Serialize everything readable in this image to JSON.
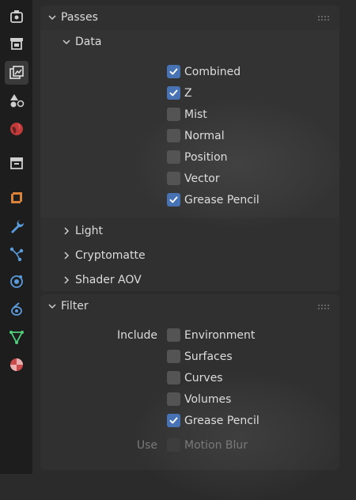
{
  "sidebar": {
    "tabs": [
      {
        "icon": "tool-icon",
        "active": false
      },
      {
        "icon": "render-icon",
        "active": false
      },
      {
        "icon": "view-layer-icon",
        "active": true
      },
      {
        "icon": "scene-icon",
        "active": false
      },
      {
        "icon": "world-icon",
        "active": false
      },
      {
        "icon": "collection-icon",
        "active": false
      },
      {
        "icon": "object-icon",
        "active": false
      },
      {
        "icon": "modifier-wrench-icon",
        "active": false
      },
      {
        "icon": "particles-icon",
        "active": false
      },
      {
        "icon": "physics-icon",
        "active": false
      },
      {
        "icon": "constraints-icon",
        "active": false
      },
      {
        "icon": "object-data-icon",
        "active": false
      },
      {
        "icon": "material-icon",
        "active": false
      }
    ]
  },
  "passes": {
    "title": "Passes",
    "data": {
      "title": "Data",
      "items": [
        {
          "label": "Combined",
          "checked": true
        },
        {
          "label": "Z",
          "checked": true
        },
        {
          "label": "Mist",
          "checked": false
        },
        {
          "label": "Normal",
          "checked": false
        },
        {
          "label": "Position",
          "checked": false
        },
        {
          "label": "Vector",
          "checked": false
        },
        {
          "label": "Grease Pencil",
          "checked": true
        }
      ]
    },
    "subpanels": [
      "Light",
      "Cryptomatte",
      "Shader AOV"
    ]
  },
  "filter": {
    "title": "Filter",
    "include_label": "Include",
    "items": [
      {
        "label": "Environment",
        "checked": false
      },
      {
        "label": "Surfaces",
        "checked": false
      },
      {
        "label": "Curves",
        "checked": false
      },
      {
        "label": "Volumes",
        "checked": false
      },
      {
        "label": "Grease Pencil",
        "checked": true
      }
    ],
    "use_label": "Use",
    "motion_blur": {
      "label": "Motion Blur",
      "checked": false,
      "enabled": false
    }
  },
  "colors": {
    "checkbox_accent": "#4772b3",
    "sidebar_bg": "#1d1d1d",
    "panel_bg": "#303030"
  }
}
